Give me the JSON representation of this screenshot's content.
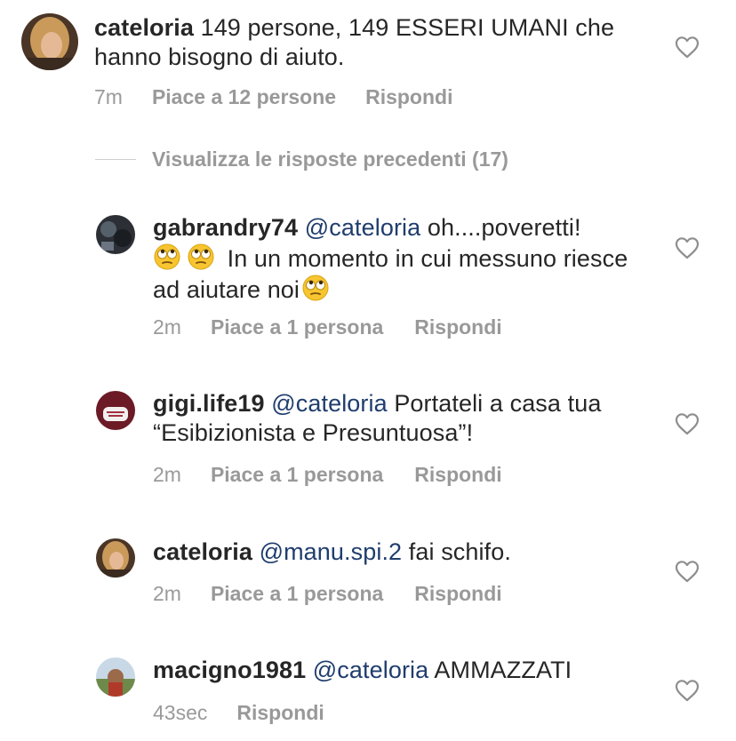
{
  "comments": [
    {
      "username": "cateloria",
      "text": "149 persone, 149 ESSERI UMANI che hanno bisogno di aiuto.",
      "time": "7m",
      "likes": "Piace a 12 persone",
      "reply": "Rispondi"
    }
  ],
  "view_previous": "Visualizza le risposte precedenti (17)",
  "replies": [
    {
      "username": "gabrandry74",
      "mention": "@cateloria",
      "text_a": "oh....poveretti!",
      "text_b": "In un momento in cui messuno riesce ad aiutare noi",
      "time": "2m",
      "likes": "Piace a 1 persona",
      "reply": "Rispondi",
      "emoji": "eye-roll-emoji"
    },
    {
      "username": "gigi.life19",
      "mention": "@cateloria",
      "text": "Portateli a casa tua “Esibizionista e Presuntuosa”!",
      "time": "2m",
      "likes": "Piace a 1 persona",
      "reply": "Rispondi"
    },
    {
      "username": "cateloria",
      "mention": "@manu.spi.2",
      "text": "fai schifo.",
      "time": "2m",
      "likes": "Piace a 1 persona",
      "reply": "Rispondi"
    },
    {
      "username": "macigno1981",
      "mention": "@cateloria",
      "text": "AMMAZZATI",
      "time": "43sec",
      "reply": "Rispondi"
    }
  ],
  "icons": {
    "like": "heart-outline-icon"
  },
  "colors": {
    "mention": "#1f3d6d",
    "meta": "#999999",
    "text": "#262626"
  }
}
